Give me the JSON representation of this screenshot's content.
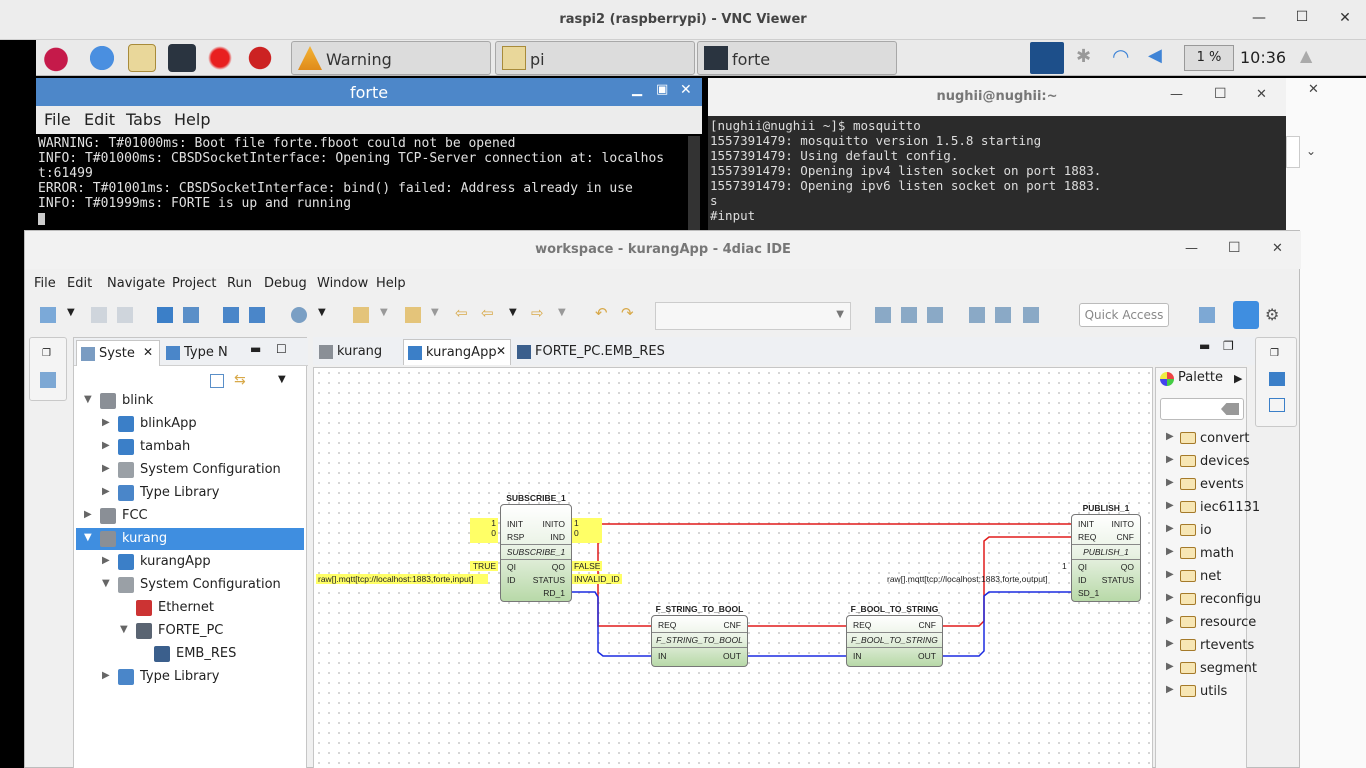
{
  "vnc": {
    "title": "raspi2 (raspberrypi) - VNC Viewer",
    "min": "—",
    "max": "☐",
    "close": "✕"
  },
  "taskbar": {
    "tasks": [
      {
        "label": "Warning"
      },
      {
        "label": "pi"
      },
      {
        "label": "forte"
      }
    ],
    "cpu": "1 %",
    "clock": "10:36"
  },
  "forte_window": {
    "title": "forte",
    "menu": [
      "File",
      "Edit",
      "Tabs",
      "Help"
    ],
    "lines": [
      "WARNING: T#01000ms: Boot file forte.fboot could not be opened",
      "INFO: T#01000ms: CBSDSocketInterface: Opening TCP-Server connection at: localhos",
      "t:61499",
      "ERROR: T#01001ms: CBSDSocketInterface: bind() failed: Address already in use",
      "INFO: T#01999ms: FORTE is up and running"
    ]
  },
  "nughii_window": {
    "title": "nughii@nughii:~",
    "lines": [
      "[nughii@nughii ~]$ mosquitto",
      "1557391479: mosquitto version 1.5.8 starting",
      "1557391479: Using default config.",
      "1557391479: Opening ipv4 listen socket on port 1883.",
      "1557391479: Opening ipv6 listen socket on port 1883.",
      "s",
      "#input"
    ]
  },
  "ide": {
    "title": "workspace - kurangApp - 4diac IDE",
    "menu": [
      "File",
      "Edit",
      "Navigate",
      "Project",
      "Run",
      "Debug",
      "Window",
      "Help"
    ],
    "quick_access": "Quick Access",
    "tree_tabs": [
      "Syste",
      "Type N"
    ],
    "tree": [
      {
        "label": "blink",
        "level": 0,
        "arrow": "▼",
        "icon": "system-icon"
      },
      {
        "label": "blinkApp",
        "level": 1,
        "arrow": "▶",
        "icon": "app-icon"
      },
      {
        "label": "tambah",
        "level": 1,
        "arrow": "▶",
        "icon": "app-icon"
      },
      {
        "label": "System Configuration",
        "level": 1,
        "arrow": "▶",
        "icon": "sysconf-icon"
      },
      {
        "label": "Type Library",
        "level": 1,
        "arrow": "▶",
        "icon": "typelib-icon"
      },
      {
        "label": "FCC",
        "level": 0,
        "arrow": "▶",
        "icon": "system-icon"
      },
      {
        "label": "kurang",
        "level": 0,
        "arrow": "▼",
        "icon": "system-icon",
        "selected": true
      },
      {
        "label": "kurangApp",
        "level": 1,
        "arrow": "▶",
        "icon": "app-icon"
      },
      {
        "label": "System Configuration",
        "level": 1,
        "arrow": "▼",
        "icon": "sysconf-icon"
      },
      {
        "label": "Ethernet",
        "level": 2,
        "arrow": "",
        "icon": "ethernet-icon"
      },
      {
        "label": "FORTE_PC",
        "level": 2,
        "arrow": "▼",
        "icon": "device-icon"
      },
      {
        "label": "EMB_RES",
        "level": 3,
        "arrow": "",
        "icon": "resource-icon"
      },
      {
        "label": "Type Library",
        "level": 1,
        "arrow": "▶",
        "icon": "typelib-icon"
      }
    ],
    "editor_tabs": [
      {
        "label": "kurang"
      },
      {
        "label": "kurangApp",
        "close": "✕"
      },
      {
        "label": "FORTE_PC.EMB_RES"
      }
    ],
    "palette": {
      "title": "Palette",
      "folders": [
        "convert",
        "devices",
        "events",
        "iec61131",
        "io",
        "math",
        "net",
        "reconfigu",
        "resource",
        "rtevents",
        "segment",
        "utils"
      ]
    },
    "diagram": {
      "subscribe": {
        "name": "SUBSCRIBE_1",
        "type": "SUBSCRIBE_1",
        "in_events": [
          "INIT",
          "RSP"
        ],
        "out_events": [
          "INITO",
          "IND"
        ],
        "in_data": [
          "QI",
          "ID"
        ],
        "out_data": [
          "QO",
          "STATUS",
          "RD_1"
        ],
        "values": {
          "init": "1",
          "rsp": "0",
          "qi": "TRUE",
          "id": "raw[].mqtt[tcp://localhost:1883,forte,input]",
          "inito": "1",
          "ind": "0",
          "qo": "FALSE",
          "status": "INVALID_ID"
        }
      },
      "f_string_to_bool": {
        "name": "F_STRING_TO_BOOL",
        "type": "F_STRING_TO_BOOL",
        "ports": [
          "REQ",
          "CNF",
          "IN",
          "OUT"
        ]
      },
      "f_bool_to_string": {
        "name": "F_BOOL_TO_STRING",
        "type": "F_BOOL_TO_STRING",
        "ports": [
          "REQ",
          "CNF",
          "IN",
          "OUT"
        ]
      },
      "publish": {
        "name": "PUBLISH_1",
        "type": "PUBLISH_1",
        "in_events": [
          "INIT",
          "REQ"
        ],
        "out_events": [
          "INITO",
          "CNF"
        ],
        "in_data": [
          "QI",
          "ID",
          "SD_1"
        ],
        "out_data": [
          "QO",
          "STATUS"
        ],
        "values": {
          "qi": "1",
          "id": "raw[].mqtt[tcp://localhost:1883,forte,output]"
        }
      }
    }
  },
  "colors": {
    "event_line": "#e01b1b",
    "data_line": "#1b2be0",
    "selection": "#3f8ee0",
    "forte_title": "#4d87c9"
  }
}
